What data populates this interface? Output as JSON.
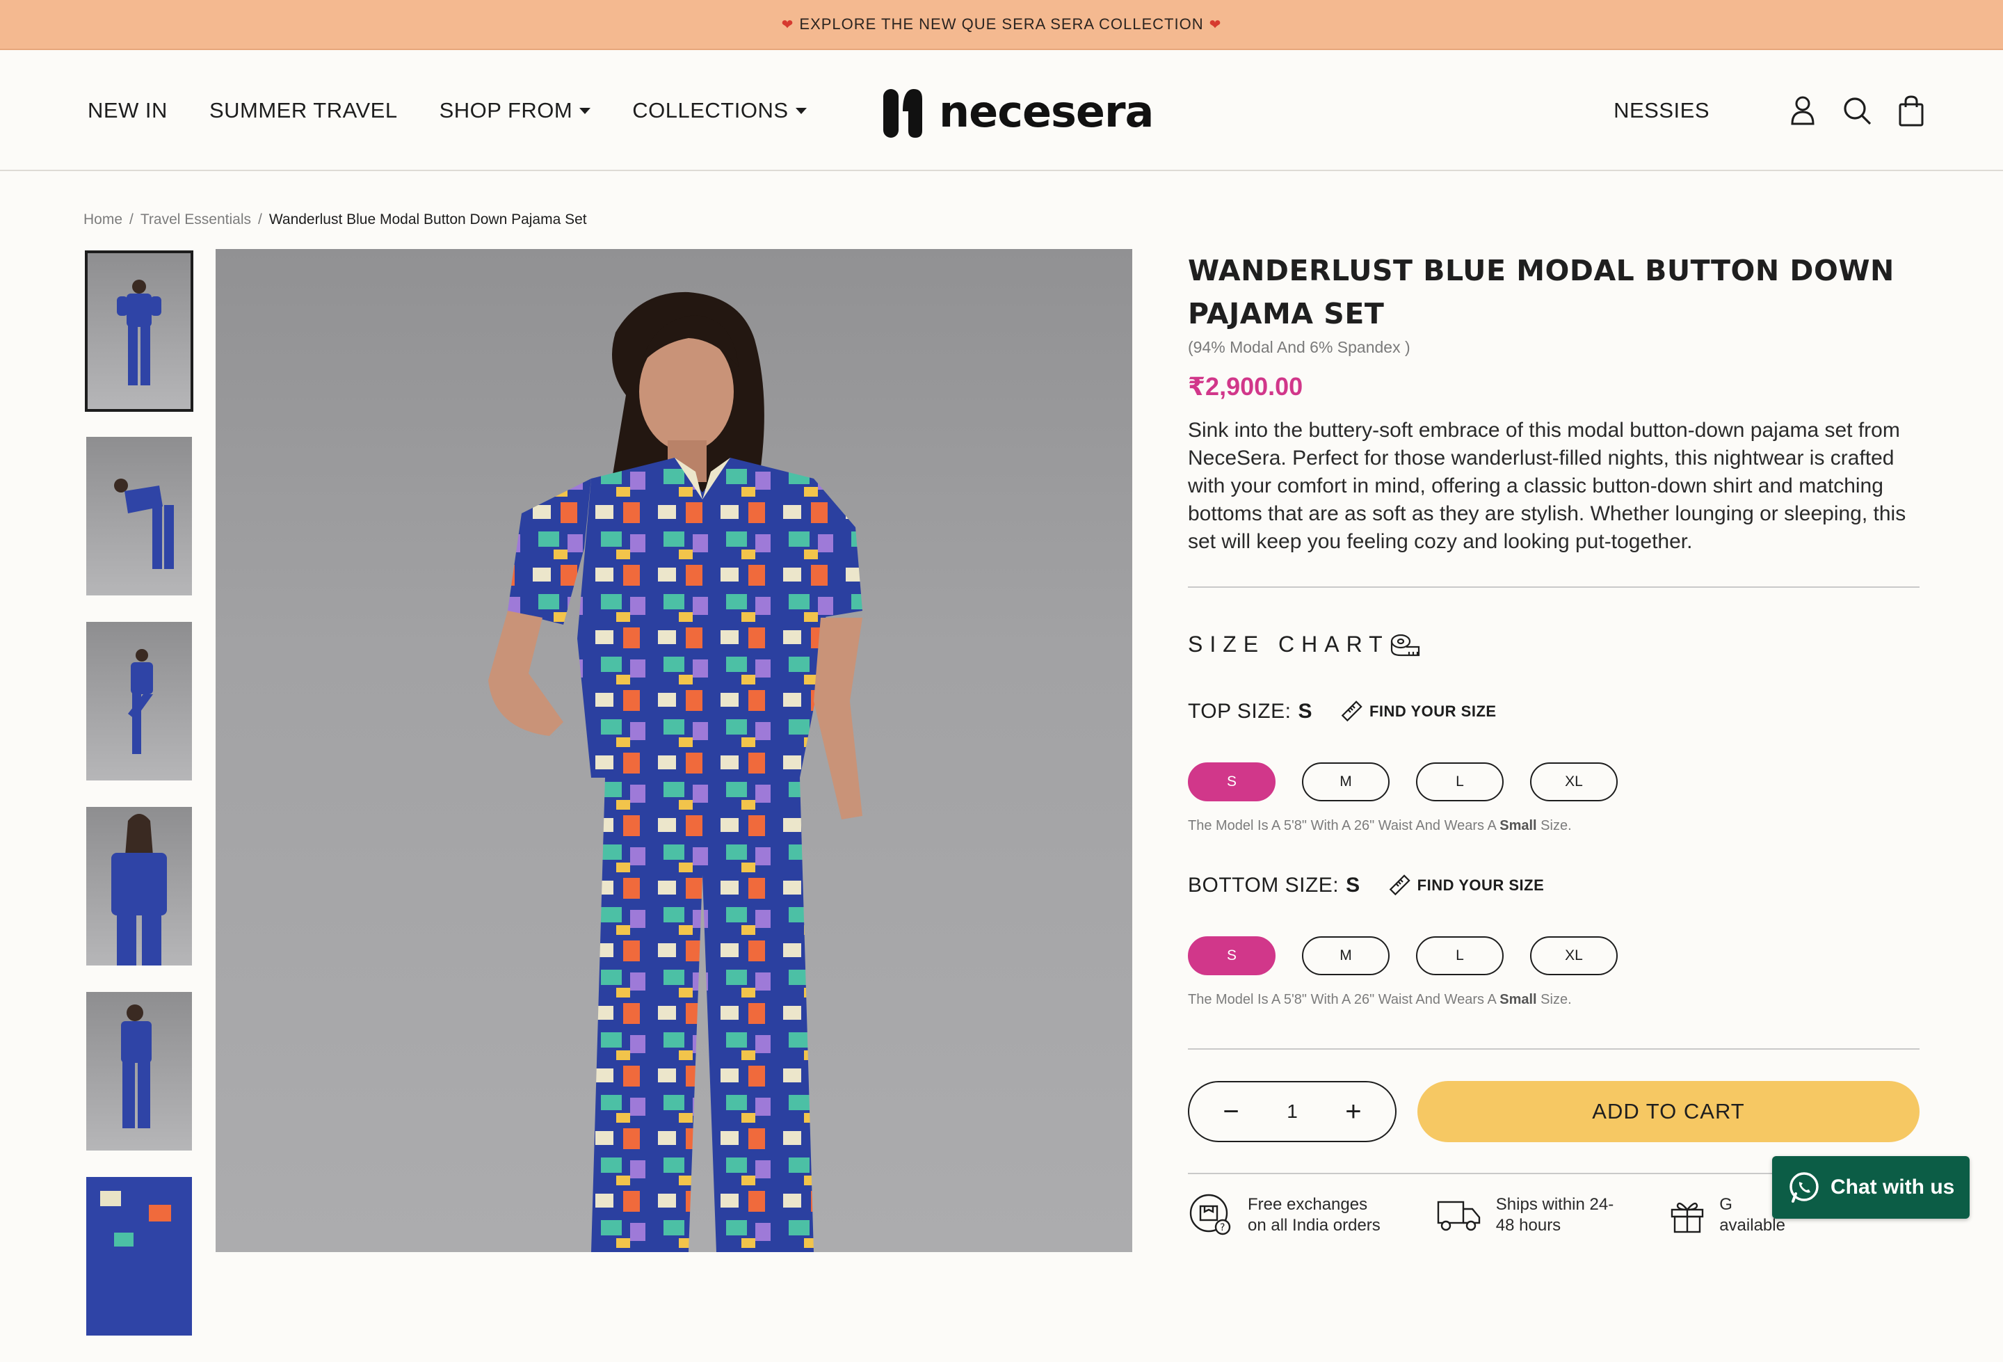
{
  "announcement": {
    "text": "EXPLORE THE NEW QUE SERA SERA COLLECTION",
    "heart": "❤"
  },
  "nav": {
    "items": [
      {
        "label": "NEW IN",
        "dropdown": false
      },
      {
        "label": "SUMMER TRAVEL",
        "dropdown": false
      },
      {
        "label": "SHOP FROM",
        "dropdown": true
      },
      {
        "label": "COLLECTIONS",
        "dropdown": true
      }
    ],
    "logo_text": "necesera",
    "nessies_label": "NESSIES",
    "icons": [
      "user-icon",
      "search-icon",
      "bag-icon"
    ]
  },
  "breadcrumb": {
    "home": "Home",
    "category": "Travel Essentials",
    "current": "Wanderlust Blue Modal Button Down Pajama Set",
    "sep": "/"
  },
  "product": {
    "title_line1": "WANDERLUST BLUE MODAL BUTTON DOWN",
    "title_line2": "PAJAMA SET",
    "fabric": "(94% Modal And 6% Spandex )",
    "price": "₹2,900.00",
    "description": "Sink into the buttery-soft embrace of this modal button-down pajama set from NeceSera. Perfect for those wanderlust-filled nights, this nightwear is crafted with your comfort in mind, offering a classic button-down shirt and matching bottoms that are as soft as they are stylish. Whether lounging or sleeping, this set will keep you feeling cozy and looking put-together.",
    "price_color": "#d1378a"
  },
  "size_chart_label": "SIZE CHART",
  "top_size": {
    "label": "TOP SIZE:",
    "selected": "S",
    "find": "FIND YOUR SIZE",
    "options": [
      "S",
      "M",
      "L",
      "XL"
    ],
    "note_pre": "The Model Is A 5'8\" With A 26\" Waist And Wears A ",
    "note_bold": "Small",
    "note_post": " Size."
  },
  "bottom_size": {
    "label": "BOTTOM SIZE:",
    "selected": "S",
    "find": "FIND YOUR SIZE",
    "options": [
      "S",
      "M",
      "L",
      "XL"
    ],
    "note_pre": "The Model Is A 5'8\" With A 26\" Waist And Wears A ",
    "note_bold": "Small",
    "note_post": " Size."
  },
  "quantity": {
    "minus": "−",
    "value": "1",
    "plus": "+"
  },
  "add_to_cart": "ADD TO CART",
  "perks": [
    {
      "line1": "Free exchanges",
      "line2": "on all India orders",
      "icon": "exchange-box-icon"
    },
    {
      "line1": "Ships within 24-",
      "line2": "48 hours",
      "icon": "truck-icon"
    },
    {
      "line1": "G",
      "line2": "available",
      "icon": "gift-icon"
    }
  ],
  "chat": {
    "label": "Chat with us",
    "color": "#0c5d46"
  },
  "colors": {
    "announcement_bg": "#f4b990",
    "accent_pink": "#d1378a",
    "cart_yellow": "#f6c863"
  }
}
